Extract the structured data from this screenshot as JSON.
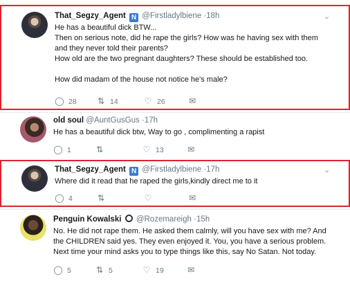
{
  "tweets": [
    {
      "name": "That_Segzy_Agent",
      "badge": "N",
      "handle": "@Firstladylbiene",
      "time": "·18h",
      "lines": [
        "He has a beautiful dick BTW...",
        "Then on serious note, did he rape the girls? How was he having sex with them",
        "and they never told their parents?",
        "How old are the two pregnant daughters? These should be established too.",
        "",
        "How did madam of the house not notice he's male?"
      ],
      "reply_count": "28",
      "retweet_count": "14",
      "like_count": "26",
      "highlighted": true
    },
    {
      "name": "old soul",
      "handle": "@AuntGusGus",
      "time": "·17h",
      "lines": [
        "He has a beautiful dick btw, Way to go , complimenting a rapist"
      ],
      "reply_count": "1",
      "retweet_count": "",
      "like_count": "13",
      "highlighted": false
    },
    {
      "name": "That_Segzy_Agent",
      "badge": "N",
      "handle": "@Firstladylbiene",
      "time": "·17h",
      "lines": [
        "Where did it read that he raped the girls,kindly direct me to it"
      ],
      "reply_count": "4",
      "retweet_count": "",
      "like_count": "",
      "highlighted": true
    },
    {
      "name": "Penguin Kowalski",
      "handle": "@Rozemareigh",
      "time": "·15h",
      "lines": [
        "No. He did not rape them. He asked them calmly, will you have sex with me? And",
        "the CHILDREN said yes. They even enjoyed it. You, you have a serious problem.",
        "Next time your mind asks you to type things like this, say No Satan. Not today."
      ],
      "reply_count": "5",
      "retweet_count": "5",
      "like_count": "19",
      "highlighted": false
    }
  ],
  "icons": {
    "reply": "reply-icon",
    "retweet": "retweet-icon",
    "like": "heart-icon",
    "message": "envelope-icon",
    "menu": "chevron-down-icon"
  },
  "colors": {
    "highlight_border": "#e0222f",
    "muted_text": "#657786",
    "verified_badge": "#3a7bd5"
  }
}
